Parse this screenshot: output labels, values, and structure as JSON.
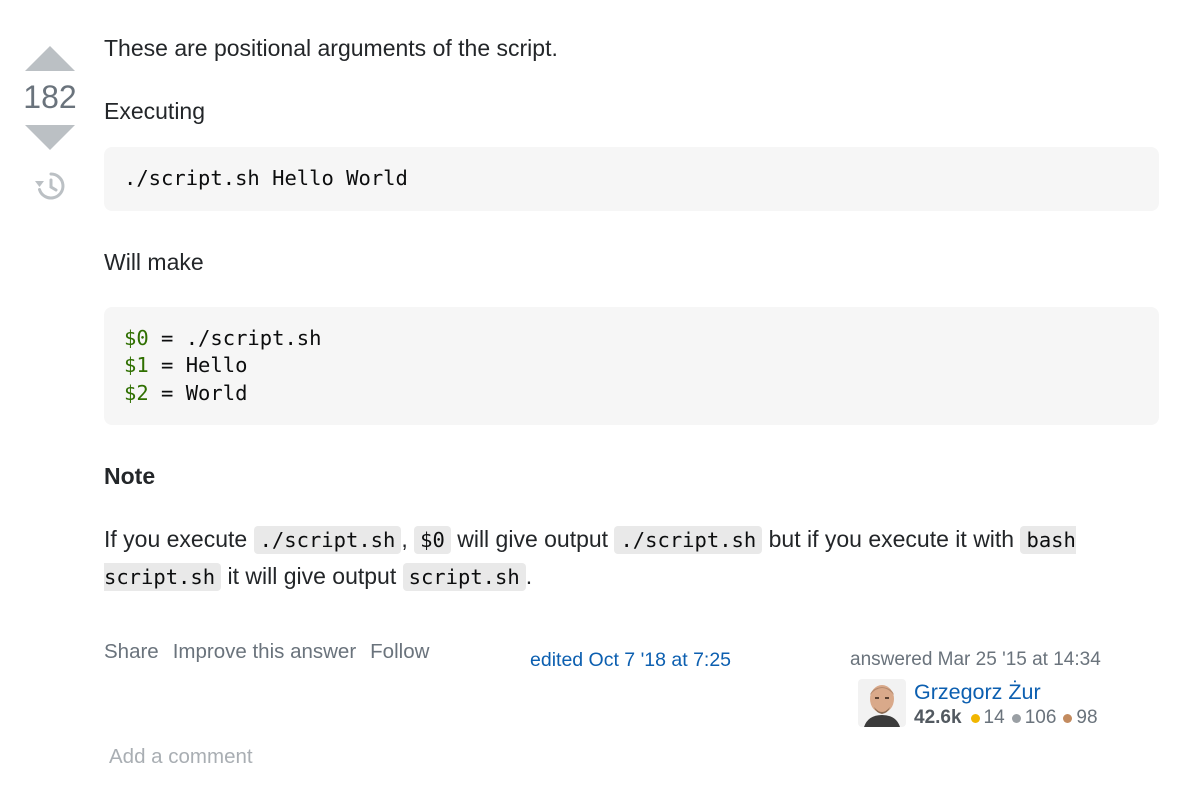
{
  "vote": {
    "count": "182",
    "upvote_icon": "triangle-up-icon",
    "downvote_icon": "triangle-down-icon",
    "history_icon": "history-icon"
  },
  "post": {
    "intro": "These are positional arguments of the script.",
    "executing_label": "Executing",
    "code_command": "./script.sh Hello World",
    "will_make_label": "Will make",
    "code_vars": [
      {
        "var": "$0",
        "rest": " = ./script.sh"
      },
      {
        "var": "$1",
        "rest": " = Hello"
      },
      {
        "var": "$2",
        "rest": " = World"
      }
    ],
    "note_heading": "Note",
    "note": {
      "t1": "If you execute ",
      "c1": "./script.sh",
      "t2": ", ",
      "c2": "$0",
      "t3": " will give output ",
      "c3": "./script.sh",
      "t4": " but if you execute it with ",
      "c4": "bash script.sh",
      "t5": " it will give output ",
      "c5": "script.sh",
      "t6": "."
    }
  },
  "menu": {
    "share": "Share",
    "improve": "Improve this answer",
    "follow": "Follow"
  },
  "edited": "edited Oct 7 '18 at 7:25",
  "user": {
    "answered": "answered Mar 25 '15 at 14:34",
    "name": "Grzegorz Żur",
    "reputation": "42.6k",
    "gold": "14",
    "silver": "106",
    "bronze": "98",
    "gold_color": "#f1b600",
    "silver_color": "#9a9fa4",
    "bronze_color": "#c38b5f"
  },
  "add_comment": "Add a comment",
  "colors": {
    "vote_arrow": "#bbc0c4",
    "link": "#0c5fb0",
    "code_bg": "#f6f6f6",
    "var_color": "#2f6f00"
  }
}
